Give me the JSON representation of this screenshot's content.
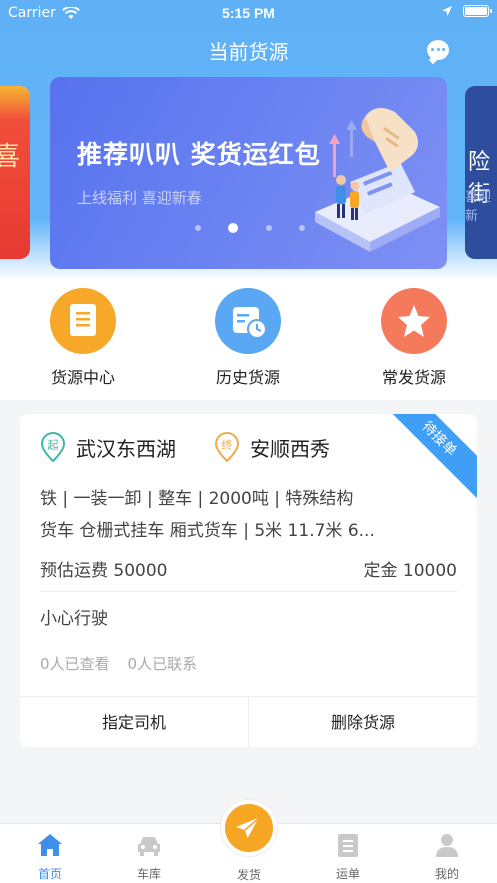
{
  "status_bar": {
    "carrier": "Carrier",
    "time": "5:15 PM"
  },
  "nav": {
    "title": "当前货源",
    "chat_icon": "chat-bubble-icon"
  },
  "banner": {
    "title": "推荐叭叭 奖货运红包",
    "subtitle": "上线福利 喜迎新春",
    "left_peek_text": "喜",
    "right_peek_text": "险 街",
    "right_peek_sub": "喜迎新"
  },
  "quick_menu": [
    {
      "label": "货源中心",
      "icon": "document-icon",
      "color": "#f7a828"
    },
    {
      "label": "历史货源",
      "icon": "history-calendar-icon",
      "color": "#5aa7f3"
    },
    {
      "label": "常发货源",
      "icon": "star-icon",
      "color": "#f57a5c"
    }
  ],
  "cargo_card": {
    "origin_tag": "起",
    "origin": "武汉东西湖",
    "dest_tag": "终",
    "destination": "安顺西秀",
    "status_badge": "待接单",
    "spec_line": "铁 | 一装一卸 | 整车 | 2000吨 | 特殊结构",
    "truck_line": "货车 仓栅式挂车 厢式货车 | 5米 11.7米 6...",
    "fee": "预估运费 50000",
    "deposit": "定金 10000",
    "note": "小心行驶",
    "viewed": "0人已查看",
    "contacted": "0人已联系",
    "action_assign": "指定司机",
    "action_delete": "删除货源"
  },
  "tabbar": {
    "home": "首页",
    "garage": "车库",
    "send": "发货",
    "orders": "运单",
    "mine": "我的"
  },
  "colors": {
    "primary": "#3f8ee8",
    "header": "#62b2f6",
    "accent": "#f6a623",
    "badge": "#3f9ef6"
  }
}
